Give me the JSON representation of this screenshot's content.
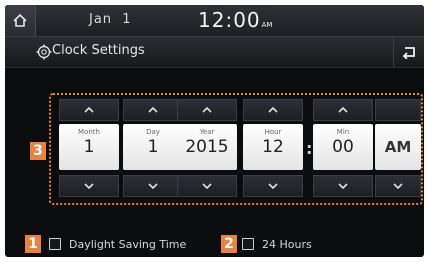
{
  "status_bar": {
    "date": "Jan  1",
    "time": "12:00",
    "time_suffix": "AM"
  },
  "title_bar": {
    "title": "Clock Settings"
  },
  "picker": {
    "columns": [
      {
        "label": "Month",
        "value": "1"
      },
      {
        "label": "Day",
        "value": "1"
      },
      {
        "label": "Year",
        "value": "2015"
      },
      {
        "label": "Hour",
        "value": "12"
      },
      {
        "label": "Min",
        "value": "00"
      },
      {
        "label": "",
        "value": "AM"
      }
    ]
  },
  "options": {
    "daylight_saving": "Daylight Saving Time",
    "hours_24": "24 Hours"
  },
  "callouts": {
    "c1": "1",
    "c2": "2",
    "c3": "3"
  },
  "colors": {
    "accent": "#e8823c",
    "background": "#0b0c0e"
  }
}
